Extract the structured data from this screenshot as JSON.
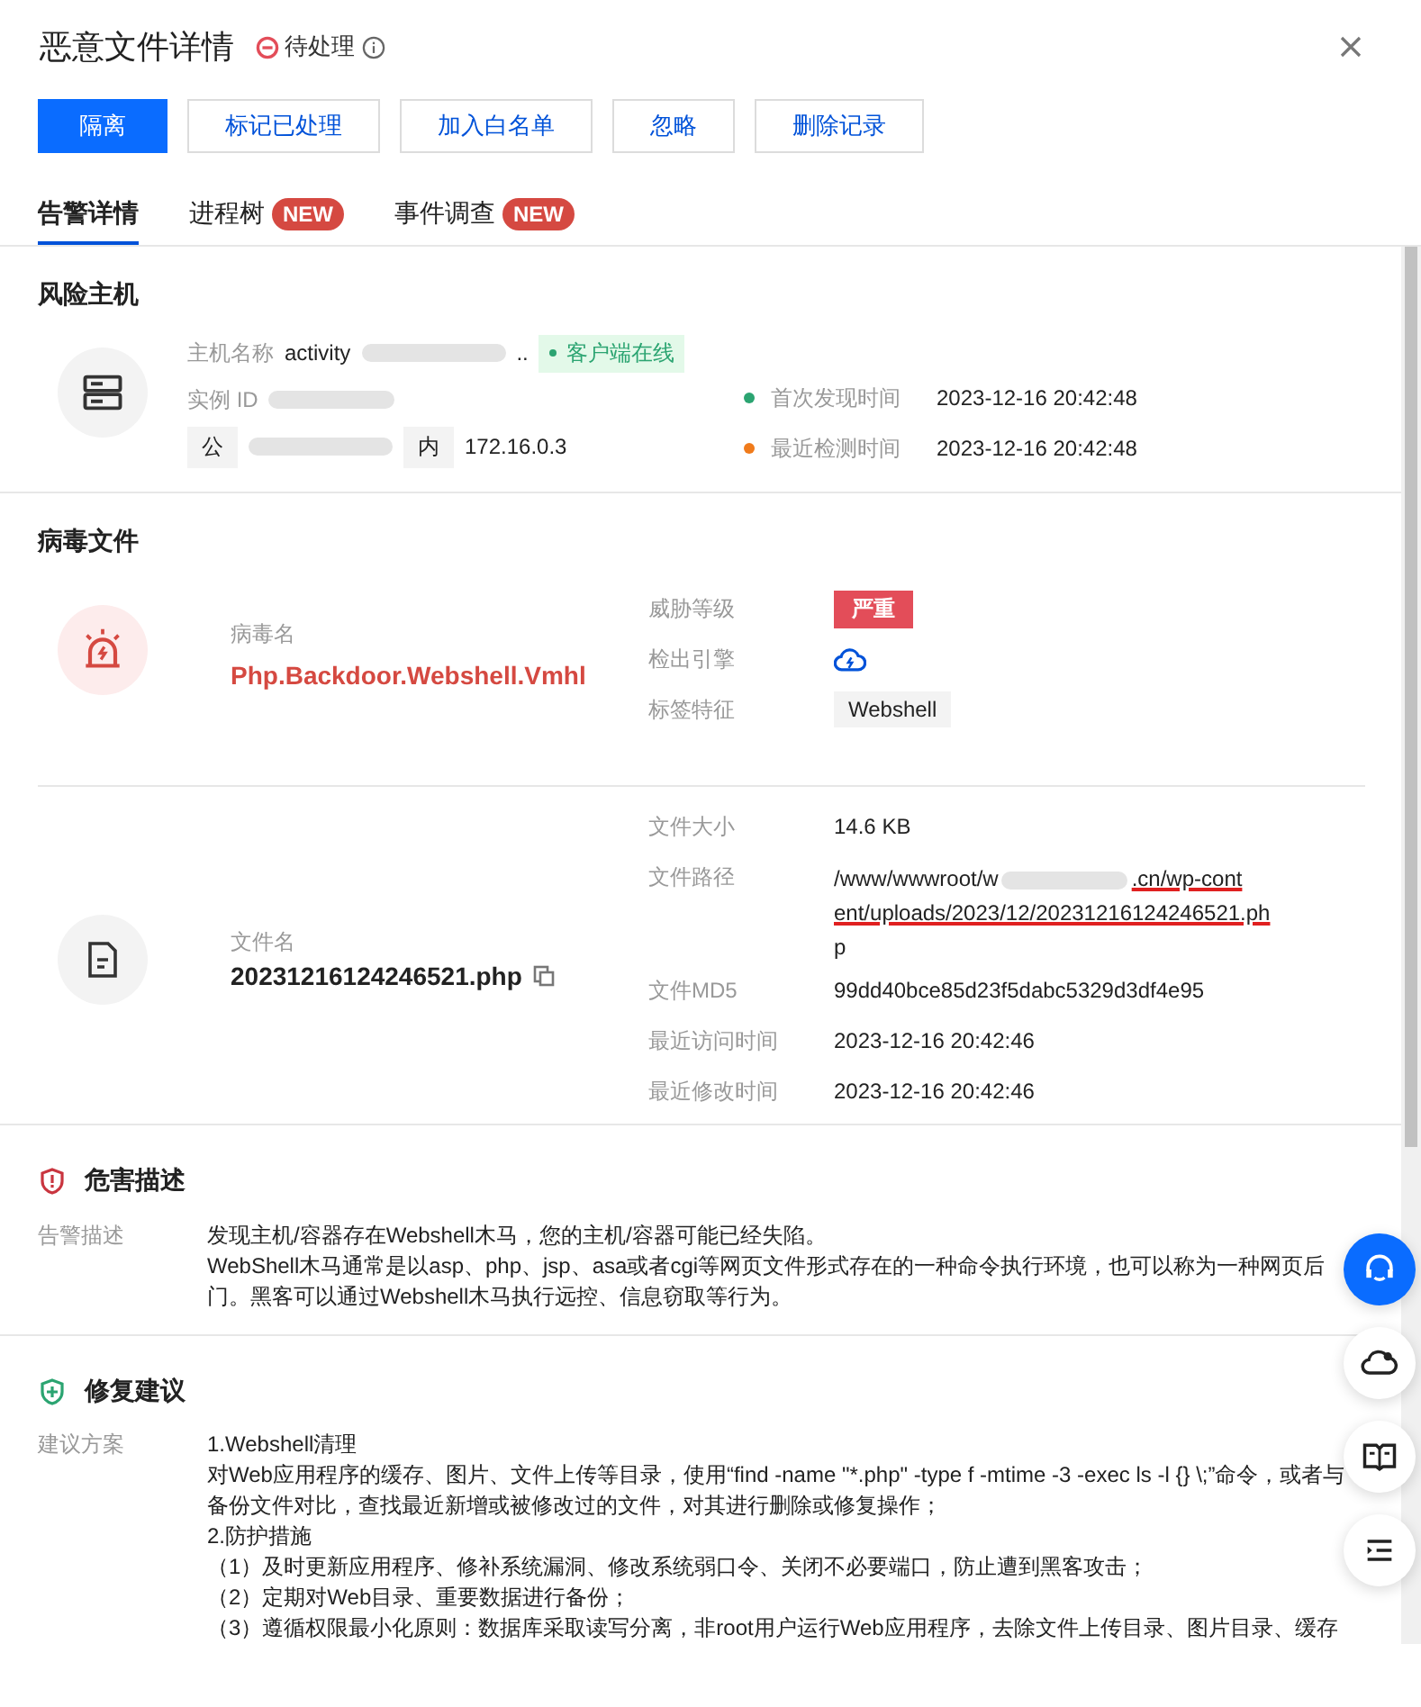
{
  "header": {
    "title": "恶意文件详情",
    "status": "待处理"
  },
  "actions": [
    {
      "label": "隔离",
      "primary": true
    },
    {
      "label": "标记已处理",
      "primary": false
    },
    {
      "label": "加入白名单",
      "primary": false
    },
    {
      "label": "忽略",
      "primary": false
    },
    {
      "label": "删除记录",
      "primary": false
    }
  ],
  "tabs": [
    {
      "label": "告警详情",
      "selected": true
    },
    {
      "label": "进程树",
      "selected": false,
      "badge": "NEW"
    },
    {
      "label": "事件调查",
      "selected": false,
      "badge": "NEW"
    }
  ],
  "host": {
    "title": "风险主机",
    "name_label": "主机名称",
    "name_parts": [
      "activity",
      ".."
    ],
    "online_tag": "客户端在线",
    "instance_label": "实例 ID",
    "public_label": "公",
    "private_label": "内",
    "private_ip": "172.16.0.3",
    "times": [
      {
        "label": "首次发现时间",
        "value": "2023-12-16 20:42:48",
        "color": "#2ba471"
      },
      {
        "label": "最近检测时间",
        "value": "2023-12-16 20:42:48",
        "color": "#f07b1b"
      }
    ]
  },
  "virus": {
    "title": "病毒文件",
    "name_label": "病毒名",
    "name": "Php.Backdoor.Webshell.Vmhl",
    "level_label": "威胁等级",
    "level": "严重",
    "engine_label": "检出引擎",
    "tag_label": "标签特征",
    "tag": "Webshell"
  },
  "file": {
    "name_label": "文件名",
    "name": "20231216124246521.php",
    "size_label": "文件大小",
    "size": "14.6 KB",
    "path_label": "文件路径",
    "path_parts": [
      "/www/wwwroot/w",
      ".cn/wp-cont",
      "ent/uploads/2023/12/20231216124246521.ph",
      "p"
    ],
    "md5_label": "文件MD5",
    "md5": "99dd40bce85d23f5dabc5329d3df4e95",
    "access_label": "最近访问时间",
    "access": "2023-12-16 20:42:46",
    "modify_label": "最近修改时间",
    "modify": "2023-12-16 20:42:46"
  },
  "harm": {
    "title": "危害描述",
    "label": "告警描述",
    "lines": [
      "发现主机/容器存在Webshell木马，您的主机/容器可能已经失陷。",
      "WebShell木马通常是以asp、php、jsp、asa或者cgi等网页文件形式存在的一种命令执行环境，也可以称为一种网页后门。黑客可以通过Webshell木马执行远控、信息窃取等行为。"
    ]
  },
  "fix": {
    "title": "修复建议",
    "label": "建议方案",
    "lines": [
      "1.Webshell清理",
      "对Web应用程序的缓存、图片、文件上传等目录，使用“find -name \"*.php\" -type f -mtime -3 -exec ls -l {} \\;”命令，或者与备份文件对比，查找最近新增或被修改过的文件，对其进行删除或修复操作；",
      "2.防护措施",
      "（1）及时更新应用程序、修补系统漏洞、修改系统弱口令、关闭不必要端口，防止遭到黑客攻击；",
      "（2）定期对Web目录、重要数据进行备份；",
      "（3）遵循权限最小化原则：数据库采取读写分离，非root用户运行Web应用程序，去除文件上传目录、图片目录、缓存"
    ]
  }
}
